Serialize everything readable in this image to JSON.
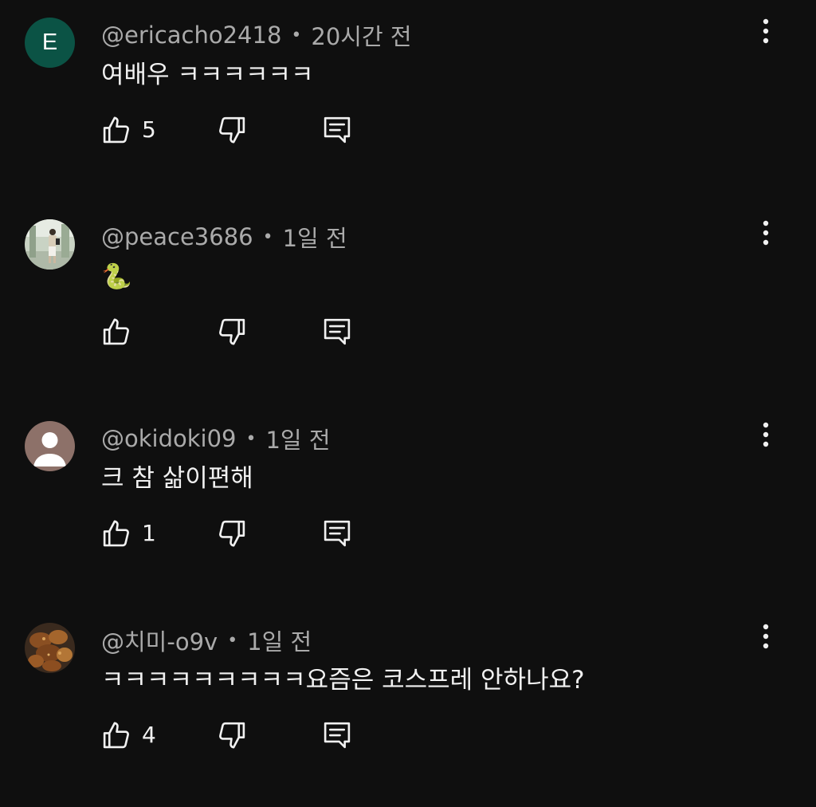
{
  "comments": [
    {
      "avatar_letter": "E",
      "avatar_color": "#0b5345",
      "author": "@ericacho2418",
      "separator": "•",
      "time": "20시간 전",
      "text": "여배우 ㅋㅋㅋㅋㅋㅋ",
      "likes": "5"
    },
    {
      "author": "@peace3686",
      "separator": "•",
      "time": "1일 전",
      "text": "🐍",
      "likes": ""
    },
    {
      "author": "@okidoki09",
      "separator": "•",
      "time": "1일 전",
      "text": "크 참 삶이편해",
      "likes": "1"
    },
    {
      "author": "@치미-o9v",
      "separator": "•",
      "time": "1일 전",
      "text": "ㅋㅋㅋㅋㅋㅋㅋㅋㅋ요즘은 코스프레 안하나요?",
      "likes": "4"
    }
  ],
  "icons": {
    "like": "thumb-up-icon",
    "dislike": "thumb-down-icon",
    "reply": "comment-reply-icon",
    "more": "more-vert-icon"
  },
  "colors": {
    "background": "#0f0f0f",
    "text": "#f1f1f1",
    "meta": "#aaaaaa"
  }
}
